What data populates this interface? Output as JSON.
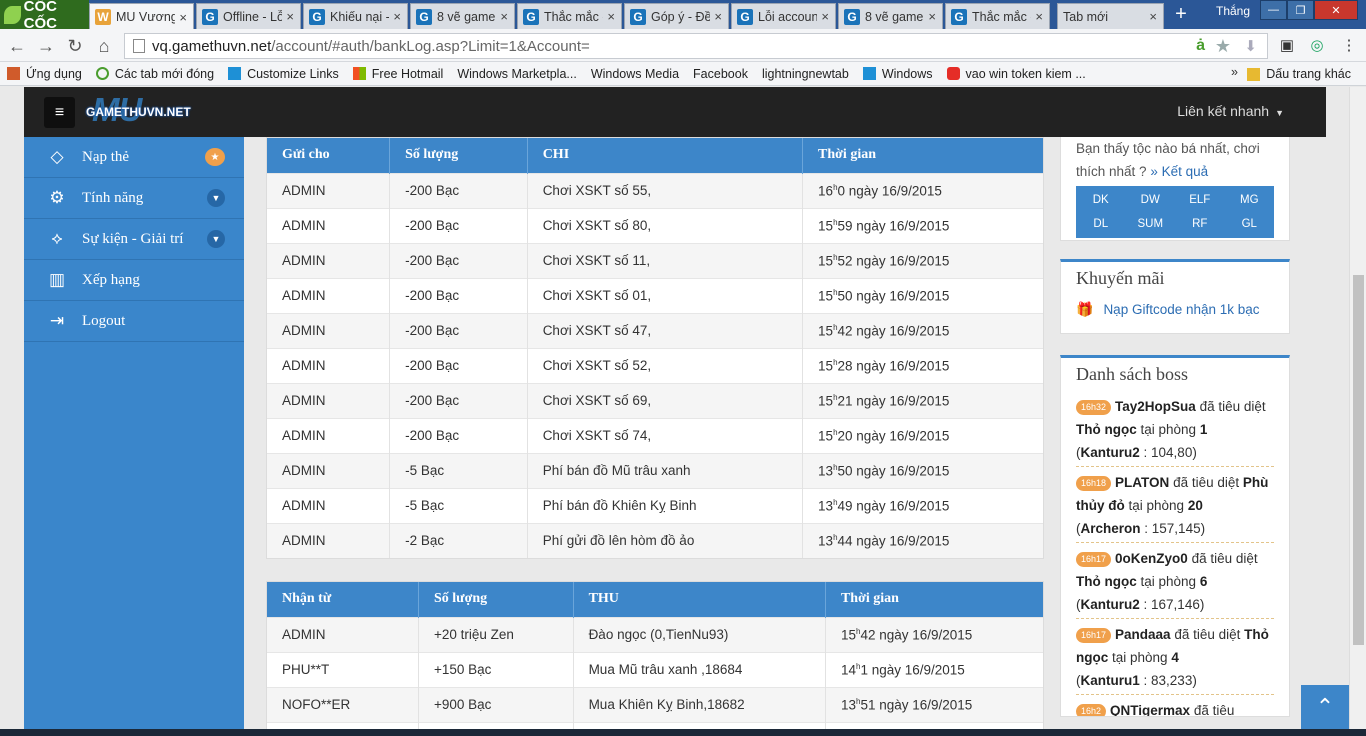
{
  "browser": {
    "brand": "CỐC CỐC",
    "tabs": [
      {
        "title": "MU Vương",
        "fav": "mu-icon",
        "active": true
      },
      {
        "title": "Offline - Lỗ",
        "fav": "g-icon"
      },
      {
        "title": "Khiếu nại -",
        "fav": "g-icon"
      },
      {
        "title": "8 vẽ game",
        "fav": "g-icon"
      },
      {
        "title": "Thắc mắc -",
        "fav": "g-icon"
      },
      {
        "title": "Góp ý - Đề",
        "fav": "g-icon"
      },
      {
        "title": "Lỗi accoun",
        "fav": "g-icon"
      },
      {
        "title": "8 vẽ game",
        "fav": "g-icon"
      },
      {
        "title": "Thắc mắc -",
        "fav": "g-icon"
      },
      {
        "title": "Tab mới",
        "fav": ""
      }
    ],
    "user": "Thắng",
    "url_host": "vq.gamethuvn.net",
    "url_path": "/account/#auth/bankLog.asp?Limit=1&Account=",
    "bookmarks": [
      {
        "label": "Ứng dụng",
        "icon": "grid"
      },
      {
        "label": "Các tab mới đóng",
        "icon": "ref"
      },
      {
        "label": "Customize Links",
        "icon": "winb"
      },
      {
        "label": "Free Hotmail",
        "icon": "win"
      },
      {
        "label": "Windows Marketpla...",
        "icon": "page"
      },
      {
        "label": "Windows Media",
        "icon": "page"
      },
      {
        "label": "Facebook",
        "icon": "page"
      },
      {
        "label": "lightningnewtab",
        "icon": "page"
      },
      {
        "label": "Windows",
        "icon": "winb"
      },
      {
        "label": "vao win token kiem ...",
        "icon": "yt"
      }
    ],
    "bookmarks_more": "»",
    "bookmarks_other": "Dấu trang khác"
  },
  "site": {
    "logo_bg": "MU",
    "logo_text": "GAMETHUVN.NET",
    "quicklinks": "Liên kết nhanh",
    "sidebar": [
      {
        "label": "Nạp thẻ",
        "icon": "◇",
        "icon_name": "diamond-icon",
        "extra": "badge",
        "extra_text": "★"
      },
      {
        "label": "Tính năng",
        "icon": "⚙",
        "icon_name": "gears-icon",
        "extra": "chev",
        "extra_text": "▼"
      },
      {
        "label": "Sự kiện - Giải trí",
        "icon": "⟡",
        "icon_name": "event-icon",
        "extra": "chev",
        "extra_text": "▼"
      },
      {
        "label": "Xếp hạng",
        "icon": "▥",
        "icon_name": "chart-icon",
        "extra": "",
        "extra_text": ""
      },
      {
        "label": "Logout",
        "icon": "⇥",
        "icon_name": "logout-icon",
        "extra": "",
        "extra_text": ""
      }
    ]
  },
  "chi_table": {
    "headers": [
      "Gửi cho",
      "Số lượng",
      "CHI",
      "Thời gian"
    ],
    "rows": [
      [
        "ADMIN",
        "-200  Bạc",
        "Chơi XSKT số 55,",
        "16",
        "h",
        "0 ngày 16/9/2015"
      ],
      [
        "ADMIN",
        "-200  Bạc",
        "Chơi XSKT số 80,",
        "15",
        "h",
        "59 ngày 16/9/2015"
      ],
      [
        "ADMIN",
        "-200  Bạc",
        "Chơi XSKT số 11,",
        "15",
        "h",
        "52 ngày 16/9/2015"
      ],
      [
        "ADMIN",
        "-200  Bạc",
        "Chơi XSKT số 01,",
        "15",
        "h",
        "50 ngày 16/9/2015"
      ],
      [
        "ADMIN",
        "-200  Bạc",
        "Chơi XSKT số 47,",
        "15",
        "h",
        "42 ngày 16/9/2015"
      ],
      [
        "ADMIN",
        "-200  Bạc",
        "Chơi XSKT số 52,",
        "15",
        "h",
        "28 ngày 16/9/2015"
      ],
      [
        "ADMIN",
        "-200  Bạc",
        "Chơi XSKT số 69,",
        "15",
        "h",
        "21 ngày 16/9/2015"
      ],
      [
        "ADMIN",
        "-200  Bạc",
        "Chơi XSKT số 74,",
        "15",
        "h",
        "20 ngày 16/9/2015"
      ],
      [
        "ADMIN",
        "-5  Bạc",
        "Phí bán đồ Mũ trâu xanh",
        "13",
        "h",
        "50 ngày 16/9/2015"
      ],
      [
        "ADMIN",
        "-5  Bạc",
        "Phí bán đồ Khiên Kỵ Binh",
        "13",
        "h",
        "49 ngày 16/9/2015"
      ],
      [
        "ADMIN",
        "-2  Bạc",
        "Phí gửi đồ lên hòm đồ ảo",
        "13",
        "h",
        "44 ngày 16/9/2015"
      ]
    ]
  },
  "thu_table": {
    "headers": [
      "Nhận từ",
      "Số lượng",
      "THU",
      "Thời gian"
    ],
    "rows": [
      [
        "ADMIN",
        "+20  triệu Zen",
        "Đào ngọc (0,TienNu93)",
        "15",
        "h",
        "42 ngày 16/9/2015"
      ],
      [
        "PHU**T",
        "+150  Bạc",
        "Mua Mũ trâu xanh ,18684",
        "14",
        "h",
        "1 ngày 16/9/2015"
      ],
      [
        "NOFO**ER",
        "+900  Bạc",
        "Mua Khiên Kỵ Binh,18682",
        "13",
        "h",
        "51 ngày 16/9/2015"
      ],
      [
        "",
        "",
        "",
        "",
        "",
        ""
      ]
    ]
  },
  "vote": {
    "question": "Bạn thấy tộc nào bá nhất, chơi thích nhất ?",
    "result_link": "» Kết quả",
    "options": [
      "DK",
      "DW",
      "ELF",
      "MG",
      "DL",
      "SUM",
      "RF",
      "GL"
    ]
  },
  "promo": {
    "title": "Khuyến mãi",
    "link": "Nạp Giftcode nhận 1k bạc"
  },
  "boss": {
    "title": "Danh sách boss",
    "entries": [
      {
        "time": "16h32",
        "player": "Tay2HopSua",
        "verb": "đã tiêu diệt",
        "boss": "Thỏ ngọc",
        "room_label": "tại phòng",
        "room": "1",
        "map": "Kanturu2",
        "coords": "104,80"
      },
      {
        "time": "16h18",
        "player": "PLATON",
        "verb": "đã tiêu diệt",
        "boss": "Phù thủy đỏ",
        "room_label": "tại phòng",
        "room": "20",
        "map": "Archeron",
        "coords": "157,145"
      },
      {
        "time": "16h17",
        "player": "0oKenZyo0",
        "verb": "đã tiêu diệt",
        "boss": "Thỏ ngọc",
        "room_label": "tại phòng",
        "room": "6",
        "map": "Kanturu2",
        "coords": "167,146"
      },
      {
        "time": "16h17",
        "player": "Pandaaa",
        "verb": "đã tiêu diệt",
        "boss": "Thỏ ngọc",
        "room_label": "tại phòng",
        "room": "4",
        "map": "Kanturu1",
        "coords": "83,233"
      },
      {
        "time": "16h2",
        "player": "QNTigermax",
        "verb": "đã tiêu",
        "boss": "",
        "room_label": "",
        "room": "",
        "map": "",
        "coords": ""
      }
    ]
  },
  "scroll_top": "⌃"
}
